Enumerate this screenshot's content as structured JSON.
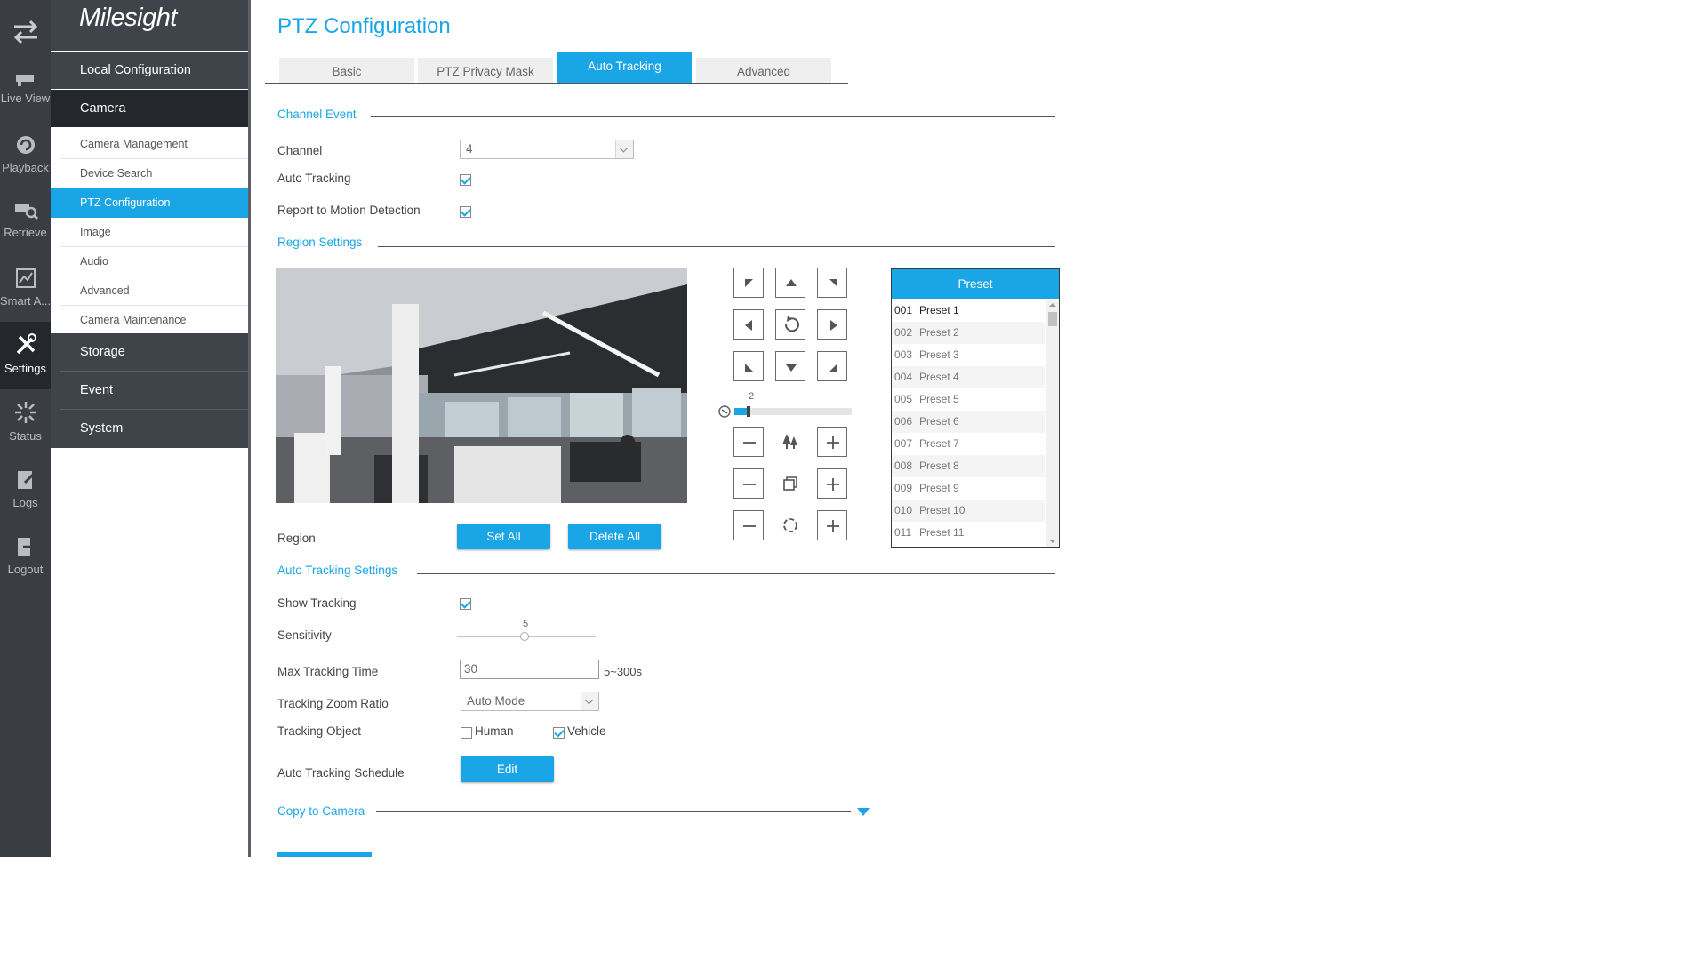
{
  "rail": [
    {
      "label": "",
      "icon": "swap-arrows-icon"
    },
    {
      "label": "Live View",
      "icon": "camera-icon"
    },
    {
      "label": "Playback",
      "icon": "playback-icon"
    },
    {
      "label": "Retrieve",
      "icon": "retrieve-icon"
    },
    {
      "label": "Smart A...",
      "icon": "smart-analysis-icon"
    },
    {
      "label": "Settings",
      "icon": "settings-tools-icon"
    },
    {
      "label": "Status",
      "icon": "status-icon"
    },
    {
      "label": "Logs",
      "icon": "logs-icon"
    },
    {
      "label": "Logout",
      "icon": "logout-icon"
    }
  ],
  "logo": "Milesight",
  "menu": {
    "local_configuration": "Local Configuration",
    "camera": "Camera",
    "sub_items": [
      "Camera Management",
      "Device Search",
      "PTZ Configuration",
      "Image",
      "Audio",
      "Advanced",
      "Camera Maintenance"
    ],
    "storage": "Storage",
    "event": "Event",
    "system": "System"
  },
  "page_title": "PTZ Configuration",
  "tabs": [
    "Basic",
    "PTZ Privacy Mask",
    "Auto Tracking",
    "Advanced"
  ],
  "sections": {
    "channel_event": "Channel Event",
    "region_settings": "Region Settings",
    "auto_tracking_settings": "Auto Tracking Settings",
    "copy_to_camera": "Copy to Camera"
  },
  "channel": {
    "label": "Channel",
    "value": "4"
  },
  "auto_tracking": {
    "label": "Auto Tracking",
    "checked": true
  },
  "report_motion": {
    "label": "Report to Motion Detection",
    "checked": true
  },
  "region": {
    "label": "Region",
    "set_all": "Set All",
    "delete_all": "Delete All"
  },
  "ptz_speed": {
    "value": "2"
  },
  "preset": {
    "header": "Preset",
    "items": [
      {
        "num": "001",
        "name": "Preset 1"
      },
      {
        "num": "002",
        "name": "Preset 2"
      },
      {
        "num": "003",
        "name": "Preset 3"
      },
      {
        "num": "004",
        "name": "Preset 4"
      },
      {
        "num": "005",
        "name": "Preset 5"
      },
      {
        "num": "006",
        "name": "Preset 6"
      },
      {
        "num": "007",
        "name": "Preset 7"
      },
      {
        "num": "008",
        "name": "Preset 8"
      },
      {
        "num": "009",
        "name": "Preset 9"
      },
      {
        "num": "010",
        "name": "Preset 10"
      },
      {
        "num": "011",
        "name": "Preset 11"
      }
    ]
  },
  "show_tracking": {
    "label": "Show Tracking",
    "checked": true
  },
  "sensitivity": {
    "label": "Sensitivity",
    "value": "5"
  },
  "max_tracking_time": {
    "label": "Max Tracking Time",
    "value": "30",
    "range": "5~300s"
  },
  "tracking_zoom_ratio": {
    "label": "Tracking Zoom Ratio",
    "value": "Auto Mode"
  },
  "tracking_object": {
    "label": "Tracking Object",
    "human": "Human",
    "human_checked": false,
    "vehicle": "Vehicle",
    "vehicle_checked": true
  },
  "schedule": {
    "label": "Auto Tracking Schedule",
    "edit": "Edit"
  },
  "colors": {
    "accent": "#1aa6e6",
    "rail": "#3a3e44",
    "menu": "#3f434a",
    "menu_dark": "#24272b"
  }
}
